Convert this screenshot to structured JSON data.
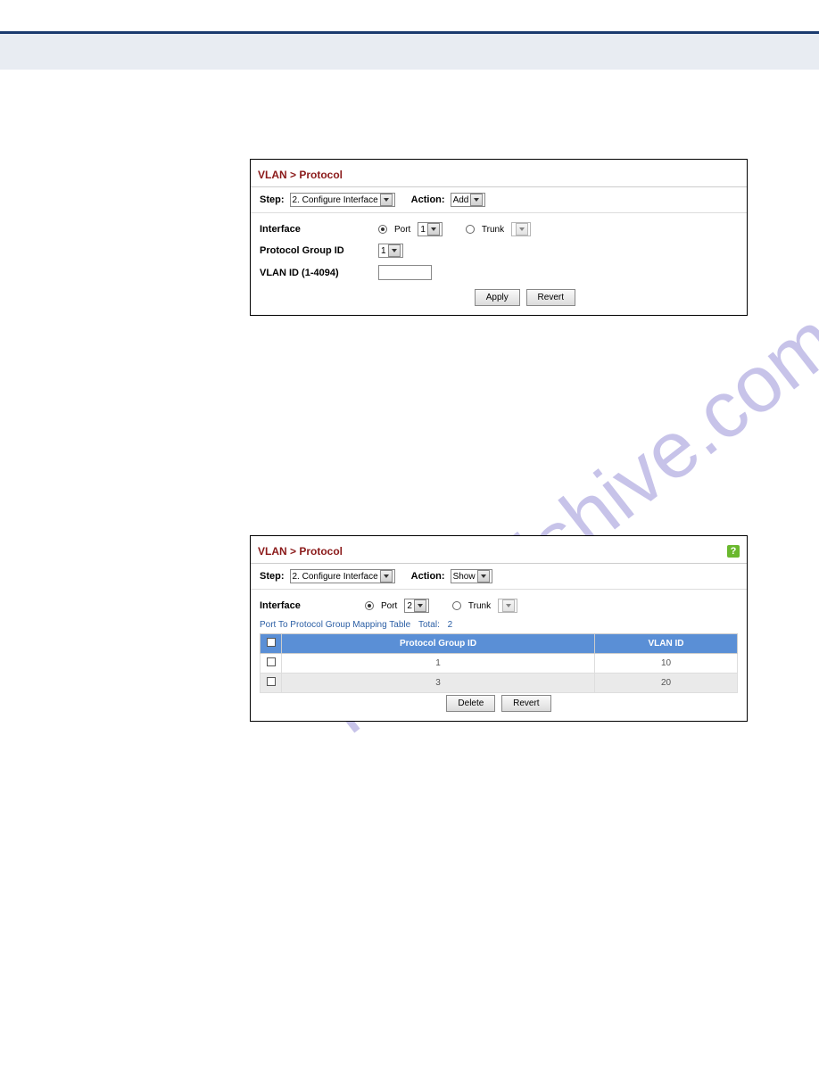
{
  "header": {
    "rule_color": "#1a3a6e"
  },
  "watermark": {
    "text": "manualshive.com"
  },
  "panel1": {
    "breadcrumb": "VLAN > Protocol",
    "step_label": "Step:",
    "step_value": "2. Configure Interface",
    "action_label": "Action:",
    "action_value": "Add",
    "interface_label": "Interface",
    "port_label": "Port",
    "port_value": "1",
    "trunk_label": "Trunk",
    "pgid_label": "Protocol Group ID",
    "pgid_value": "1",
    "vlanid_label": "VLAN ID (1-4094)",
    "vlanid_value": "",
    "apply_label": "Apply",
    "revert_label": "Revert"
  },
  "panel2": {
    "breadcrumb": "VLAN > Protocol",
    "step_label": "Step:",
    "step_value": "2. Configure Interface",
    "action_label": "Action:",
    "action_value": "Show",
    "interface_label": "Interface",
    "port_label": "Port",
    "port_value": "2",
    "trunk_label": "Trunk",
    "table_name": "Port To Protocol Group Mapping Table",
    "table_total_label": "Total:",
    "table_total": "2",
    "col_pgid": "Protocol Group ID",
    "col_vlan": "VLAN ID",
    "rows": [
      {
        "pgid": "1",
        "vlan": "10"
      },
      {
        "pgid": "3",
        "vlan": "20"
      }
    ],
    "delete_label": "Delete",
    "revert_label": "Revert"
  },
  "chart_data": {
    "type": "table",
    "title": "Port To Protocol Group Mapping Table",
    "columns": [
      "Protocol Group ID",
      "VLAN ID"
    ],
    "rows": [
      [
        "1",
        "10"
      ],
      [
        "3",
        "20"
      ]
    ],
    "total": 2
  }
}
